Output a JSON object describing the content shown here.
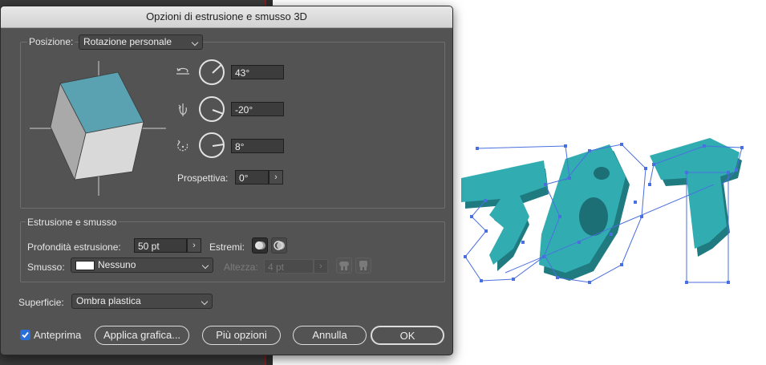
{
  "dialog": {
    "title": "Opzioni di estrusione e smusso 3D",
    "position": {
      "label": "Posizione:",
      "preset": "Rotazione personale",
      "rot_x": "43°",
      "rot_y": "-20°",
      "rot_z": "8°",
      "perspective_label": "Prospettiva:",
      "perspective": "0°"
    },
    "extrude": {
      "section_title": "Estrusione e smusso",
      "depth_label": "Profondità estrusione:",
      "depth": "50 pt",
      "caps_label": "Estremi:",
      "bevel_label": "Smusso:",
      "bevel": "Nessuno",
      "height_label": "Altezza:",
      "height": "4 pt"
    },
    "surface": {
      "label": "Superficie:",
      "value": "Ombra plastica"
    },
    "buttons": {
      "preview": "Anteprima",
      "preview_checked": true,
      "map_art": "Applica grafica...",
      "more_options": "Più opzioni",
      "cancel": "Annulla",
      "ok": "OK"
    }
  },
  "preview_art": {
    "text": "3GT",
    "color": "#2fa9ae"
  },
  "colors": {
    "cube_top": "#5aa2b2",
    "selection": "#4a6fe0",
    "accent": "#2a6fd9"
  }
}
